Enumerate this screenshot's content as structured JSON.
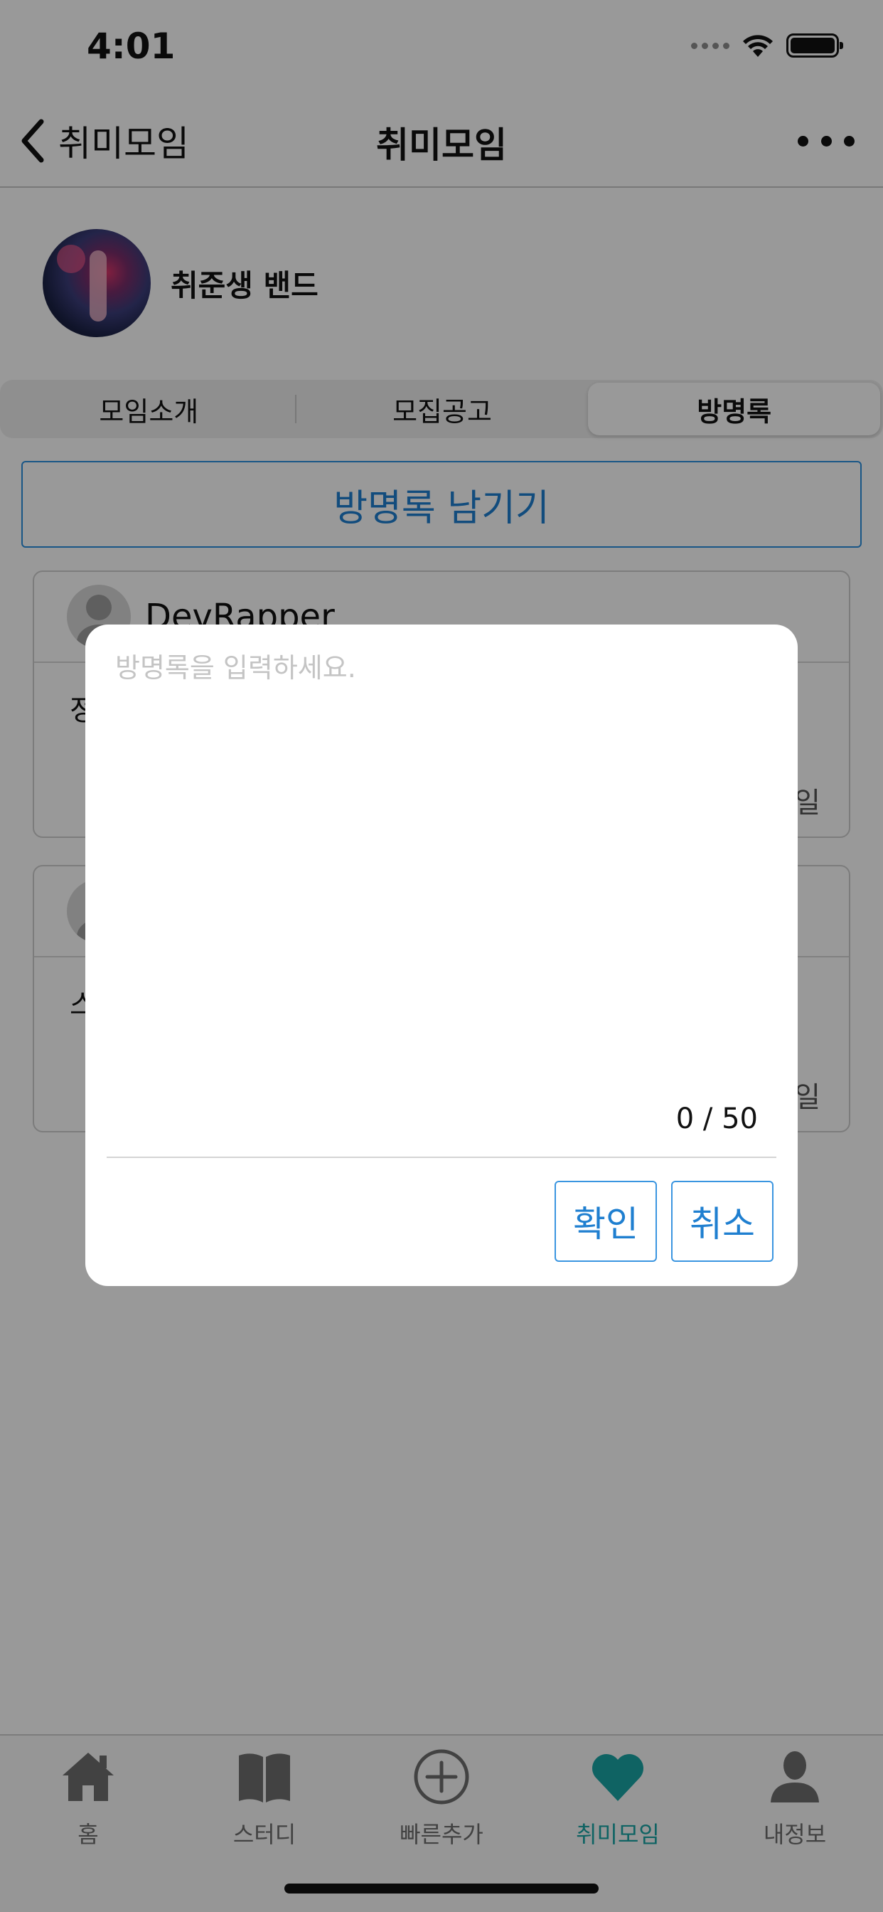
{
  "status_bar": {
    "time": "4:01"
  },
  "nav": {
    "back_label": "취미모임",
    "title": "취미모임"
  },
  "group": {
    "name": "취준생 밴드"
  },
  "segments": [
    {
      "label": "모임소개",
      "active": false
    },
    {
      "label": "모집공고",
      "active": false
    },
    {
      "label": "방명록",
      "active": true
    }
  ],
  "write_button": {
    "label": "방명록 남기기"
  },
  "guestbook": [
    {
      "user": "DevRapper",
      "body": "정",
      "date": "일"
    },
    {
      "user": "",
      "body": "스",
      "date": "일"
    }
  ],
  "modal": {
    "placeholder": "방명록을 입력하세요.",
    "value": "",
    "counter": "0 / 50",
    "confirm_label": "확인",
    "cancel_label": "취소"
  },
  "tab_bar": {
    "items": [
      {
        "label": "홈",
        "icon": "home-icon",
        "active": false
      },
      {
        "label": "스터디",
        "icon": "book-icon",
        "active": false
      },
      {
        "label": "빠른추가",
        "icon": "plus-circle-icon",
        "active": false
      },
      {
        "label": "취미모임",
        "icon": "heart-icon",
        "active": true
      },
      {
        "label": "내정보",
        "icon": "person-icon",
        "active": false
      }
    ]
  },
  "colors": {
    "accent_blue": "#1f7fd0",
    "tab_active": "#1aa6a6",
    "overlay": "rgba(0,0,0,0.40)"
  }
}
